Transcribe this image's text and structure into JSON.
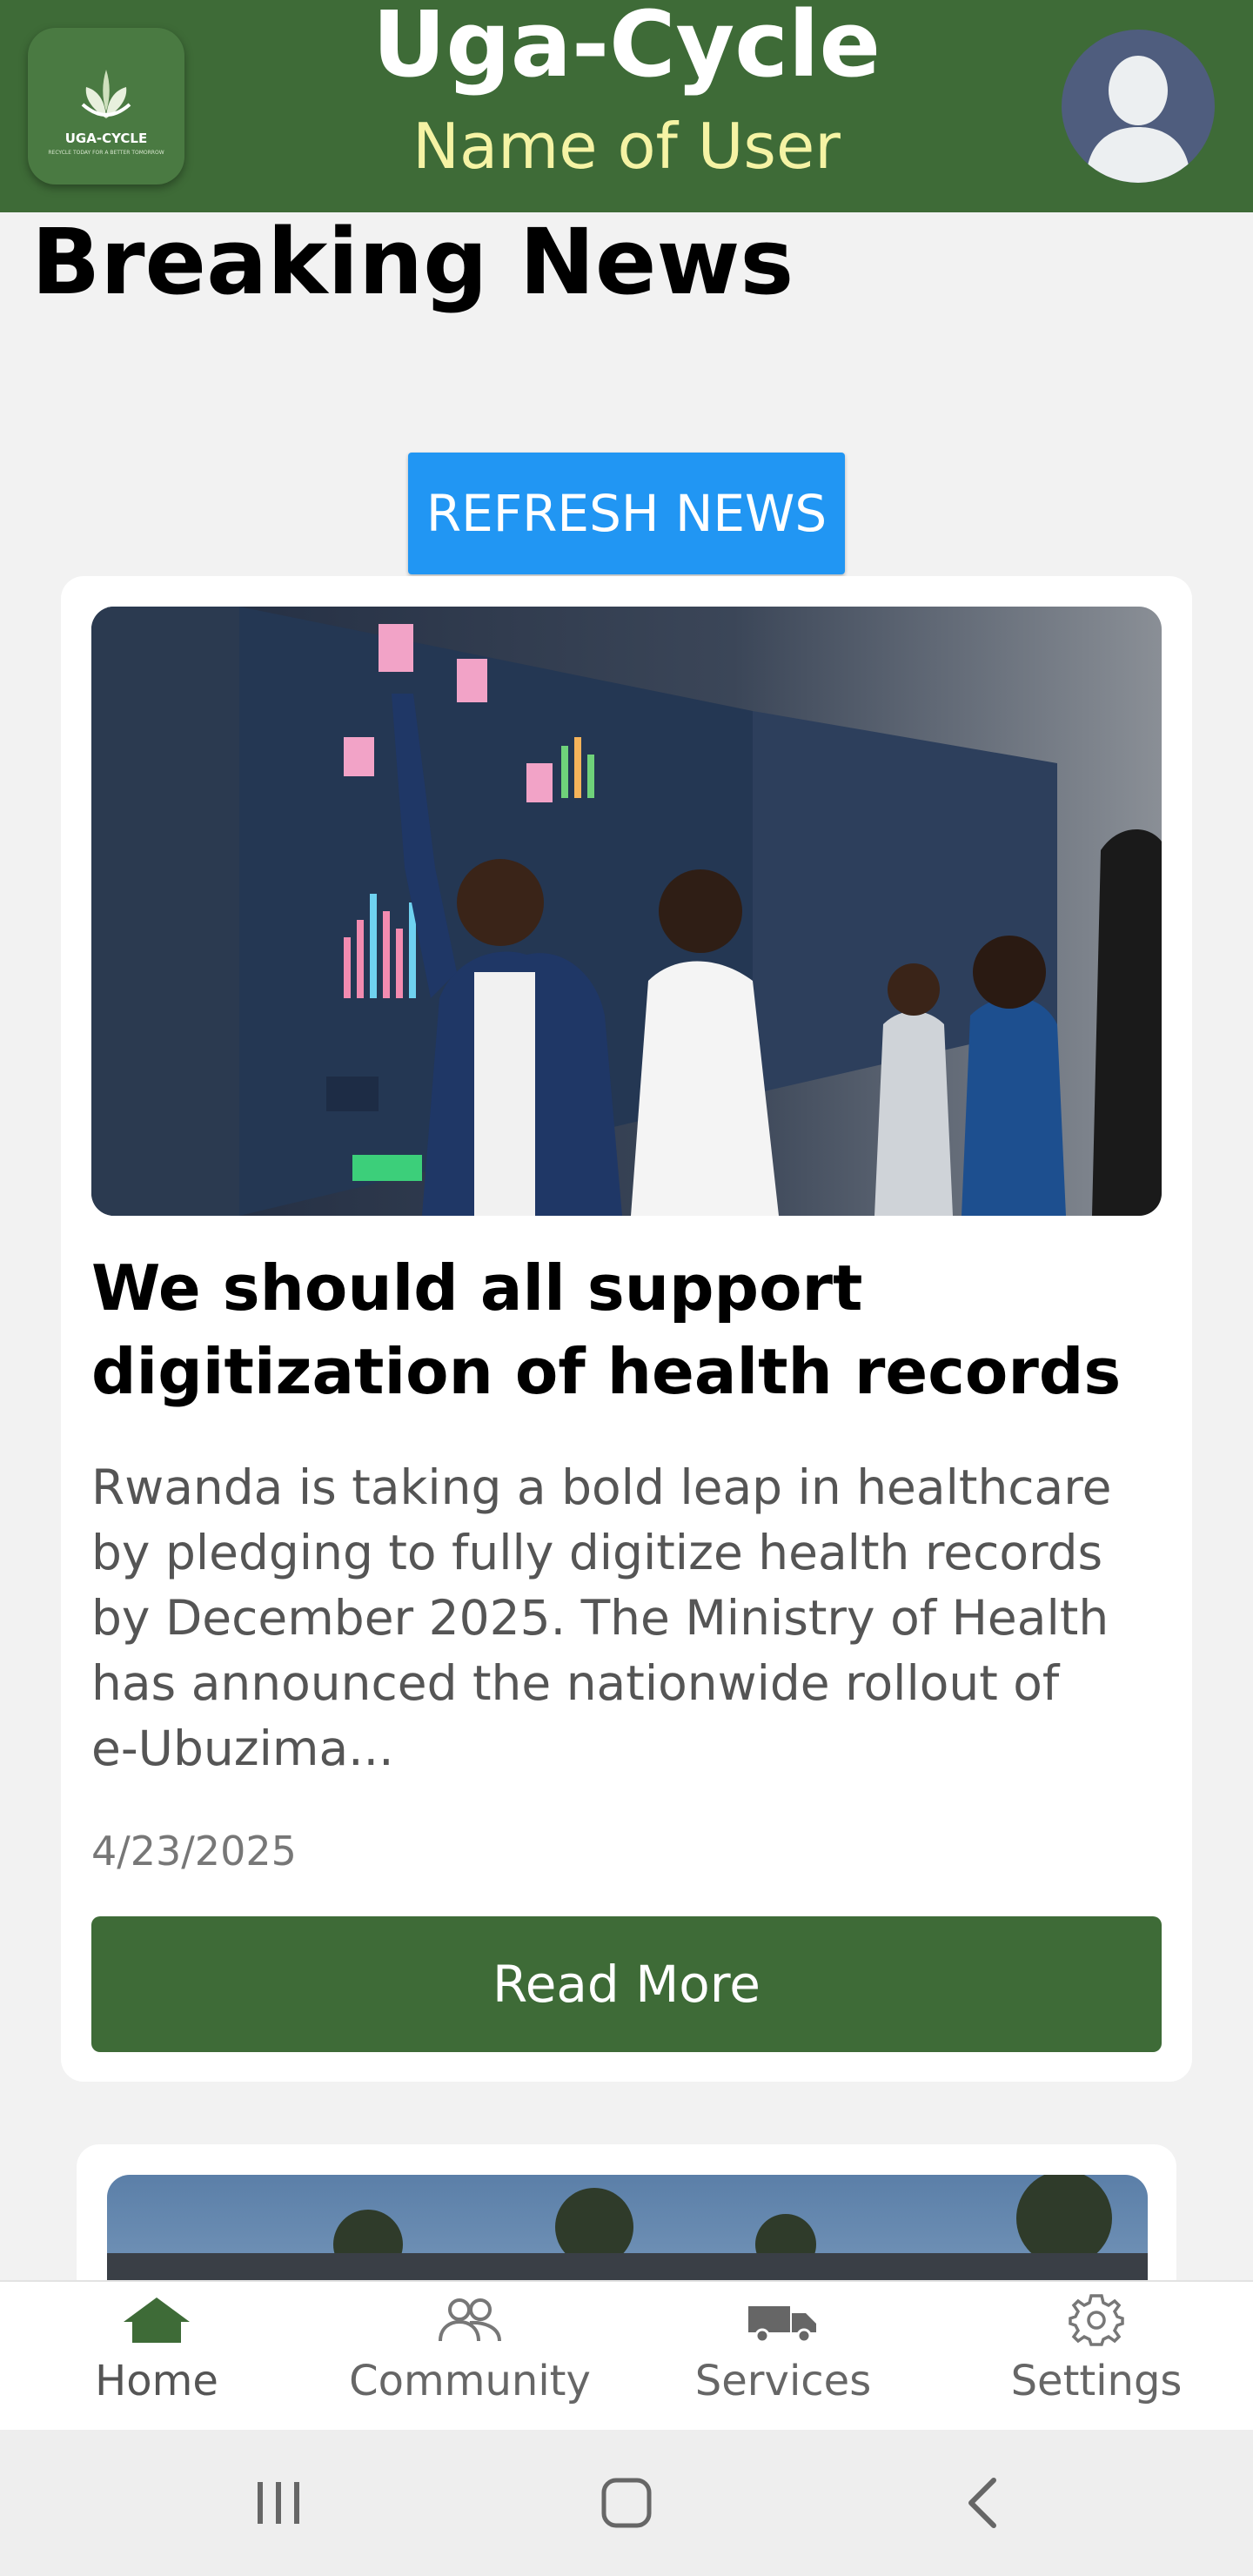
{
  "header": {
    "logo_text": "UGA-CYCLE",
    "logo_tagline": "RECYCLE TODAY FOR A BETTER TOMORROW",
    "app_title": "Uga-Cycle",
    "user_name": "Name of User",
    "colors": {
      "bar": "#3e6b37",
      "user_name": "#f5f3a4",
      "avatar_bg": "#4f5d7e"
    }
  },
  "page": {
    "heading": "Breaking News",
    "refresh_label": "REFRESH NEWS",
    "refresh_color": "#2196f3"
  },
  "articles": [
    {
      "title": "We should all support digitization of health records",
      "summary": "Rwanda is taking a bold leap in healthcare by pledging to fully digitize health records by December 2025. The Ministry of Health has announced the nationwide rollout of e-Ubuzima...",
      "date": "4/23/2025",
      "read_more_label": "Read More",
      "image_icon": "health-data-dashboard-photo"
    },
    {
      "image_icon": "outdoor-crowd-photo"
    }
  ],
  "bottom_nav": {
    "items": [
      {
        "label": "Home",
        "icon": "home-icon",
        "active": true
      },
      {
        "label": "Community",
        "icon": "community-icon",
        "active": false
      },
      {
        "label": "Services",
        "icon": "truck-icon",
        "active": false
      },
      {
        "label": "Settings",
        "icon": "gear-icon",
        "active": false
      }
    ],
    "active_color": "#3e6b37"
  },
  "system_nav": {
    "icons": [
      "recent-apps-icon",
      "home-circle-icon",
      "back-icon"
    ]
  }
}
